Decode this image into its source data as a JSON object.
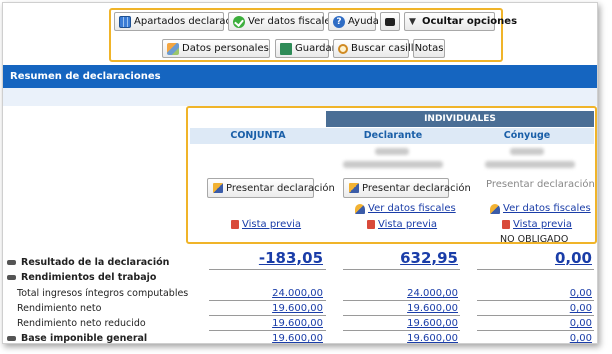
{
  "toolbar": {
    "apartados": "Apartados declaración",
    "ver_datos_fiscales": "Ver datos fiscales",
    "ayuda": "Ayuda",
    "ocultar_opciones": "Ocultar opciones",
    "datos_personales": "Datos personales",
    "guardar": "Guardar",
    "buscar_casilla": "Buscar casilla",
    "notas": "Notas"
  },
  "header": {
    "title": "Resumen de declaraciones"
  },
  "declaraciones": {
    "individuales_label": "INDIVIDUALES",
    "columns": {
      "conjunta": "CONJUNTA",
      "declarante": "Declarante",
      "conyuge": "Cónyuge"
    },
    "presentar_label": "Presentar declaración",
    "ver_datos_fiscales": "Ver datos fiscales",
    "vista_previa": "Vista previa",
    "no_obligado": "NO OBLIGADO"
  },
  "rows": [
    {
      "label": "Resultado de la declaración",
      "bold": true,
      "conjunta": "-183,05",
      "declarante": "632,95",
      "conyuge": "0,00"
    },
    {
      "label": "Rendimientos del trabajo",
      "bold": true
    },
    {
      "label": "Total ingresos íntegros computables",
      "conjunta": "24.000,00",
      "declarante": "24.000,00",
      "conyuge": "0,00"
    },
    {
      "label": "Rendimiento neto",
      "conjunta": "19.600,00",
      "declarante": "19.600,00",
      "conyuge": "0,00"
    },
    {
      "label": "Rendimiento neto reducido",
      "conjunta": "19.600,00",
      "declarante": "19.600,00",
      "conyuge": "0,00"
    },
    {
      "label": "Base imponible general",
      "bold": true,
      "conjunta": "19.600,00",
      "declarante": "19.600,00",
      "conyuge": "0,00"
    }
  ],
  "colors": {
    "accent_blue": "#1565c0",
    "highlight_border": "#f0b429",
    "link_blue": "#1a3da8",
    "individuales_bg": "#4a6e95"
  }
}
